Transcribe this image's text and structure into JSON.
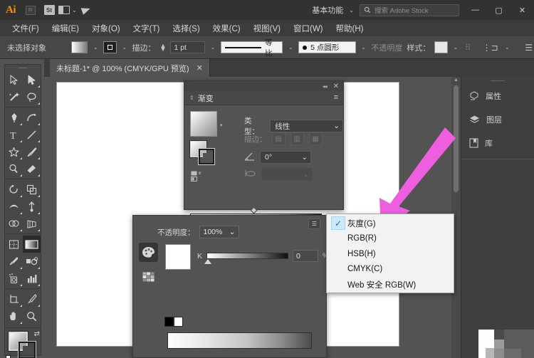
{
  "app": {
    "name": "Ai",
    "workspace": "基本功能",
    "search_placeholder": "搜索 Adobe Stock",
    "titlebar_icons": [
      "bridge-icon",
      "stock-icon",
      "arrange-documents-icon",
      "share-icon"
    ],
    "window_buttons": {
      "minimize": "—",
      "maximize": "▢",
      "close": "✕"
    }
  },
  "menubar": {
    "items": [
      {
        "label": "文件(F)",
        "name": "menu-file"
      },
      {
        "label": "编辑(E)",
        "name": "menu-edit"
      },
      {
        "label": "对象(O)",
        "name": "menu-object"
      },
      {
        "label": "文字(T)",
        "name": "menu-type"
      },
      {
        "label": "选择(S)",
        "name": "menu-select"
      },
      {
        "label": "效果(C)",
        "name": "menu-effect"
      },
      {
        "label": "视图(V)",
        "name": "menu-view"
      },
      {
        "label": "窗口(W)",
        "name": "menu-window"
      },
      {
        "label": "帮助(H)",
        "name": "menu-help"
      }
    ]
  },
  "controlbar": {
    "selection_status": "未选择对象",
    "stroke_label": "描边：",
    "stroke_weight": "1 pt",
    "profile_label": "等比",
    "brush_label": "5 点圆形",
    "opacity_label": "不透明度",
    "style_label": "样式："
  },
  "tabs": [
    {
      "title": "未标题-1* @ 100% (CMYK/GPU 预览)",
      "close": "✕"
    }
  ],
  "toolbar": {
    "tools": [
      "selection-tool",
      "direct-selection-tool",
      "magic-wand-tool",
      "lasso-tool",
      "pen-tool",
      "curvature-tool",
      "type-tool",
      "line-segment-tool",
      "shape-tool",
      "paintbrush-tool",
      "pencil-tool",
      "eraser-tool",
      "rotate-tool",
      "scale-tool",
      "width-tool",
      "free-transform-tool",
      "shape-builder-tool",
      "perspective-grid-tool",
      "mesh-tool",
      "gradient-tool",
      "eyedropper-tool",
      "blend-tool",
      "symbol-sprayer-tool",
      "column-graph-tool",
      "artboard-tool",
      "slice-tool",
      "hand-tool",
      "zoom-tool"
    ],
    "selected_tool": "gradient-tool"
  },
  "gradient_panel": {
    "title": "渐变",
    "type_label": "类型：",
    "type_value": "线性",
    "stroke_label": "描边：",
    "angle_label": "角度",
    "angle_value": "0°",
    "aspect_placeholder": "",
    "collapse_icon": "collapse-icon",
    "close_icon": "close-icon",
    "menu_icon": "panel-menu-icon",
    "delete_icon": "trash-icon",
    "gradient_css": "linear-gradient(to right,#ffffff,#1a1a1a)"
  },
  "color_panel": {
    "opacity_label": "不透明度：",
    "opacity_value": "100%",
    "channel_label": "K",
    "channel_value": "0",
    "percent_sign": "%",
    "menu_icon": "panel-menu-icon",
    "color-mixer-icon": "palette-icon",
    "swatches-icon": "swatches-grid-icon",
    "fill_color": "#ffffff"
  },
  "dropdown": {
    "name": "color-mode-menu",
    "items": [
      {
        "label": "灰度(G)",
        "checked": true
      },
      {
        "label": "RGB(R)",
        "checked": false
      },
      {
        "label": "HSB(H)",
        "checked": false
      },
      {
        "label": "CMYK(C)",
        "checked": false
      },
      {
        "label": "Web 安全 RGB(W)",
        "checked": false
      }
    ],
    "check_glyph": "✓"
  },
  "right_dock": {
    "items": [
      {
        "label": "属性",
        "icon": "properties-icon"
      },
      {
        "label": "图层",
        "icon": "layers-icon"
      },
      {
        "label": "库",
        "icon": "libraries-icon"
      }
    ]
  },
  "annotation": {
    "arrow_color": "#ee5fe0",
    "name": "pink-arrow-annotation"
  },
  "colors": {
    "titlebar_bg": "#323232",
    "menubar_bg": "#3c3c3c",
    "control_bg": "#474747",
    "panel_bg": "#535353",
    "canvas_bg": "#535353",
    "artboard": "#ffffff",
    "accent_orange": "#f79400",
    "menu_highlight": "#cde8fa"
  }
}
